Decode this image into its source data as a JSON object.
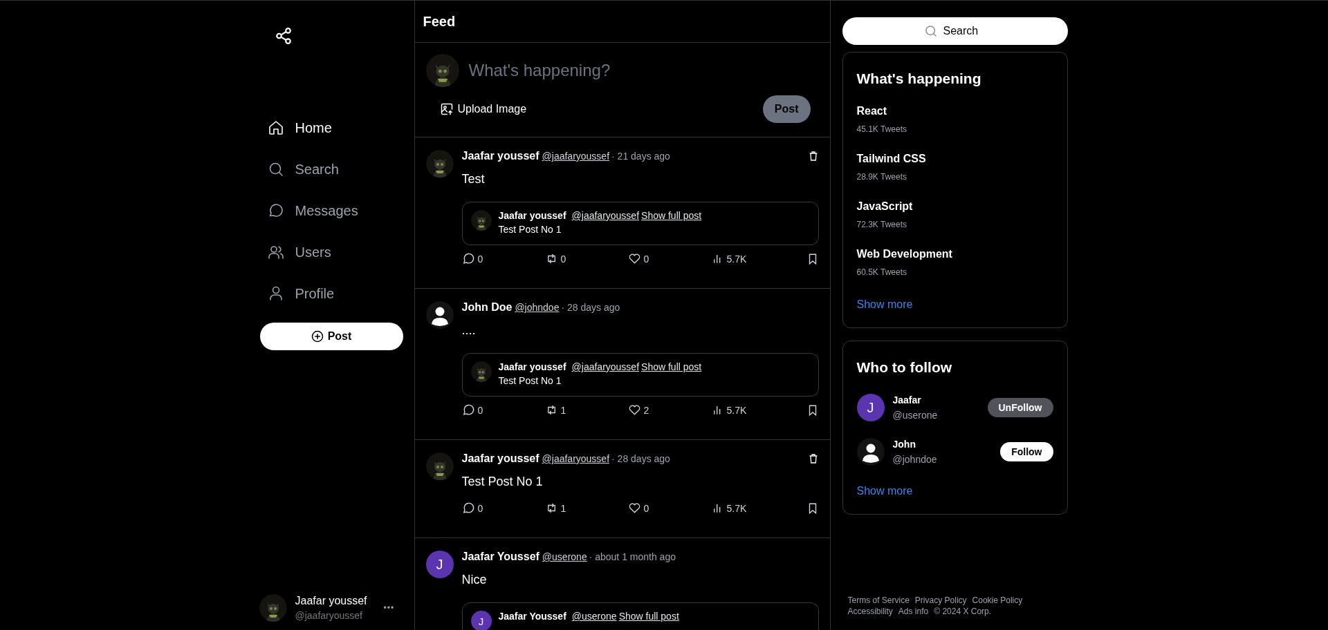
{
  "nav": {
    "items": [
      {
        "label": "Home",
        "kind": "home",
        "selected": true
      },
      {
        "label": "Search",
        "kind": "search",
        "selected": false
      },
      {
        "label": "Messages",
        "kind": "messages",
        "selected": false
      },
      {
        "label": "Users",
        "kind": "users",
        "selected": false
      },
      {
        "label": "Profile",
        "kind": "profile",
        "selected": false
      }
    ],
    "post_button": "Post"
  },
  "account": {
    "name": "Jaafar youssef",
    "handle": "@jaafaryoussef",
    "more": "•••"
  },
  "feed": {
    "title": "Feed",
    "composer": {
      "placeholder": "What's happening?",
      "upload_label": "Upload Image",
      "post_button": "Post",
      "post_disabled": true
    },
    "posts": [
      {
        "name": "Jaafar youssef",
        "handle": "@jaafaryoussef",
        "time": "· 21 days ago",
        "can_delete": true,
        "text": "Test",
        "quote": {
          "name": "Jaafar youssef",
          "handle": "@jaafaryoussef",
          "link": "Show full post",
          "text": "Test Post No 1"
        },
        "replies": "0",
        "reposts": "0",
        "likes": "0",
        "views": "5.7K"
      },
      {
        "name": "John Doe",
        "handle": "@johndoe",
        "time": "· 28 days ago",
        "avatar": {
          "kind": "default"
        },
        "can_delete": false,
        "text": "....",
        "quote": {
          "name": "Jaafar youssef",
          "handle": "@jaafaryoussef",
          "link": "Show full post",
          "text": "Test Post No 1"
        },
        "replies": "0",
        "reposts": "1",
        "likes": "2",
        "views": "5.7K"
      },
      {
        "name": "Jaafar youssef",
        "handle": "@jaafaryoussef",
        "time": "· 28 days ago",
        "can_delete": true,
        "text": "Test Post No 1",
        "replies": "0",
        "reposts": "1",
        "likes": "0",
        "views": "5.7K"
      },
      {
        "name": "Jaafar Youssef",
        "handle": "@userone",
        "time": "· about 1 month ago",
        "avatar": {
          "kind": "letter",
          "letter": "J",
          "color": "#5b34b0"
        },
        "can_delete": false,
        "text": "Nice",
        "quote": {
          "name": "Jaafar Youssef",
          "handle": "@userone",
          "link": "Show full post",
          "avatar": {
            "kind": "letter",
            "letter": "J",
            "color": "#5b34b0"
          }
        }
      }
    ]
  },
  "search": {
    "placeholder": "Search"
  },
  "trending": {
    "title": "What's happening",
    "items": [
      {
        "topic": "React",
        "count": "45.1K Tweets"
      },
      {
        "topic": "Tailwind CSS",
        "count": "28.9K Tweets"
      },
      {
        "topic": "JavaScript",
        "count": "72.3K Tweets"
      },
      {
        "topic": "Web Development",
        "count": "60.5K Tweets"
      }
    ],
    "show_more": "Show more"
  },
  "who_to_follow": {
    "title": "Who to follow",
    "users": [
      {
        "name": "Jaafar",
        "handle": "@userone",
        "avatar": {
          "kind": "letter",
          "letter": "J",
          "color": "#5b34b0"
        },
        "following": true,
        "button": "UnFollow"
      },
      {
        "name": "John",
        "handle": "@johndoe",
        "avatar": {
          "kind": "default"
        },
        "following": false,
        "button": "Follow"
      }
    ],
    "show_more": "Show more"
  },
  "footer": [
    "Terms of Service",
    "Privacy Policy",
    "Cookie Policy",
    "Accessibility",
    "Ads info",
    "© 2024 X Corp."
  ]
}
